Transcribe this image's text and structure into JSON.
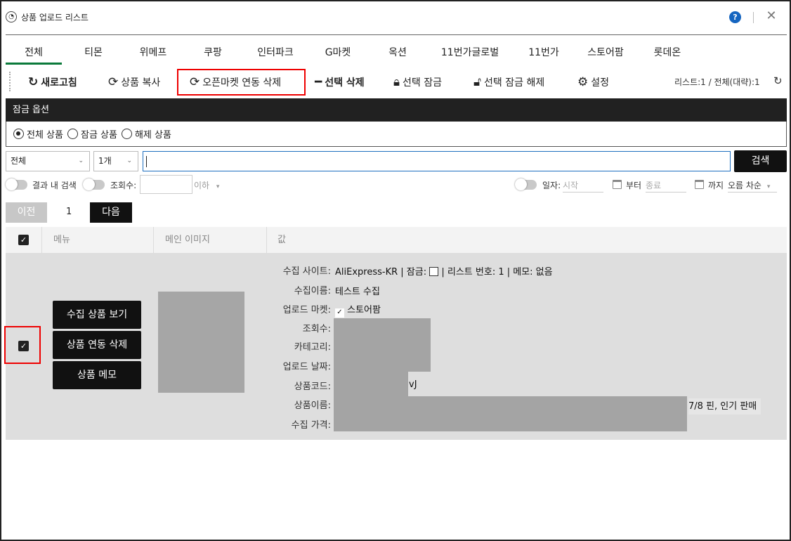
{
  "window": {
    "title": "상품 업로드 리스트",
    "help": "?",
    "close": "✕"
  },
  "tabs": [
    "전체",
    "티몬",
    "위메프",
    "쿠팡",
    "인터파크",
    "G마켓",
    "옥션",
    "11번가글로벌",
    "11번가",
    "스토어팜",
    "롯데온"
  ],
  "toolbar": {
    "refresh": "새로고침",
    "copy": "상품 복사",
    "open_delete": "오픈마켓 연동 삭제",
    "select_delete": "선택 삭제",
    "select_lock": "선택 잠금",
    "select_unlock": "선택 잠금 해제",
    "settings": "설정",
    "list_count": "리스트:1  /  전체(대략):1"
  },
  "lock_options": {
    "title": "잠금 옵션",
    "all": "전체 상품",
    "locked": "잠금 상품",
    "unlocked": "해제 상품"
  },
  "search": {
    "category_value": "전체",
    "count_value": "1개",
    "button": "검색"
  },
  "filters": {
    "in_result": "결과 내 검색",
    "views": "조회수:",
    "below": "이하",
    "date": "일자:",
    "start": "시작",
    "from": "부터",
    "end": "종료",
    "to": "까지",
    "sort": "오름 차순"
  },
  "pagination": {
    "prev": "이전",
    "page": "1",
    "next": "다음"
  },
  "table": {
    "headers": {
      "menu": "메뉴",
      "image": "메인 이미지",
      "value": "값"
    },
    "row": {
      "buttons": {
        "view": "수집 상품 보기",
        "unlink": "상품 연동 삭제",
        "memo": "상품 메모"
      },
      "labels": {
        "site": "수집 사이트:",
        "name": "수집이름:",
        "market": "업로드 마켓:",
        "views": "조회수:",
        "category": "카테고리:",
        "date": "업로드 날짜:",
        "code": "상품코드:",
        "title": "상품이름:",
        "price": "수집 가격:"
      },
      "site_value": "AliExpress-KR",
      "lock_label": "| 잠금:",
      "list_no": "| 리스트 번호: 1 | 메모: 없음",
      "name_value": "테스트 수집",
      "market_value": "스토어팜",
      "code_suffix": "vJ",
      "title_suffix": "7/8 핀, 인기 판매"
    }
  }
}
